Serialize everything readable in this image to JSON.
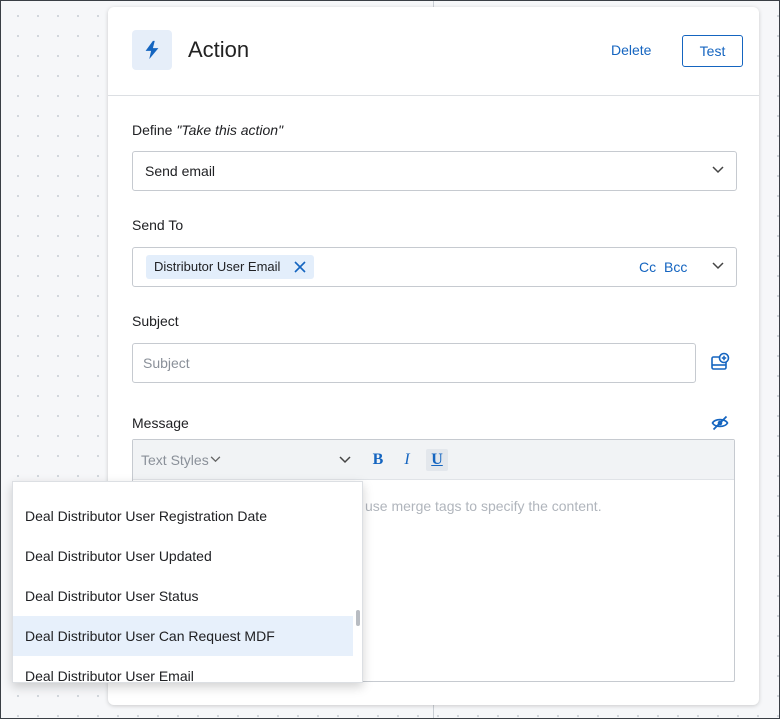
{
  "header": {
    "title": "Action",
    "delete_label": "Delete",
    "test_label": "Test",
    "icon": "lightning-bolt-icon"
  },
  "define": {
    "label_prefix": "Define ",
    "label_em": "\"Take this action\"",
    "value": "Send email"
  },
  "send_to": {
    "label": "Send To",
    "chip": "Distributor User Email",
    "cc_label": "Cc",
    "bcc_label": "Bcc"
  },
  "subject": {
    "label": "Subject",
    "placeholder": "Subject"
  },
  "message": {
    "label": "Message",
    "text_styles": "Text Styles",
    "bold_label": "B",
    "italic_label": "I",
    "underline_label": "U",
    "placeholder": "use merge tags to specify the content."
  },
  "dropdown": {
    "items": [
      "Deal Distributor User Registration Date",
      "Deal Distributor User Updated",
      "Deal Distributor User Status",
      "Deal Distributor User Can Request MDF",
      "Deal Distributor User Email"
    ],
    "highlighted_index": 3
  },
  "colors": {
    "accent": "#1565c0",
    "highlight": "#e7f0fb"
  }
}
